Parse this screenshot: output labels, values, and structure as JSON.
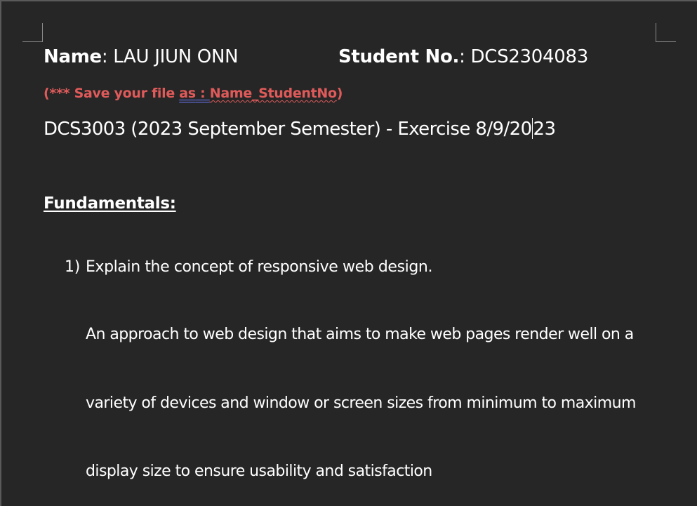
{
  "document": {
    "name_label": "Name",
    "name_value": ": LAU JIUN ONN",
    "student_no_label": "Student No.",
    "student_no_value": ": DCS2304083",
    "save_note": {
      "prefix": "(*** Save your file ",
      "as": "as",
      "colon": " : ",
      "filename": "Name_StudentNo",
      "suffix": ")"
    },
    "course_line": {
      "before_cursor": "DCS3003 (2023 September Semester) - Exercise 8/9/20",
      "after_cursor": "23"
    },
    "section_heading": "Fundamentals:",
    "questions": [
      {
        "number": "1)",
        "text": "Explain the concept of responsive web design.",
        "answer_lines": [
          "An approach to web design that aims to make web pages render well on a",
          "variety of devices and window or screen sizes from minimum to maximum",
          "display size to ensure usability and satisfaction"
        ]
      }
    ]
  },
  "colors": {
    "page_background": "#262626",
    "note_red": "#e05a5a",
    "grammar_underline_blue": "#6b7cff"
  }
}
